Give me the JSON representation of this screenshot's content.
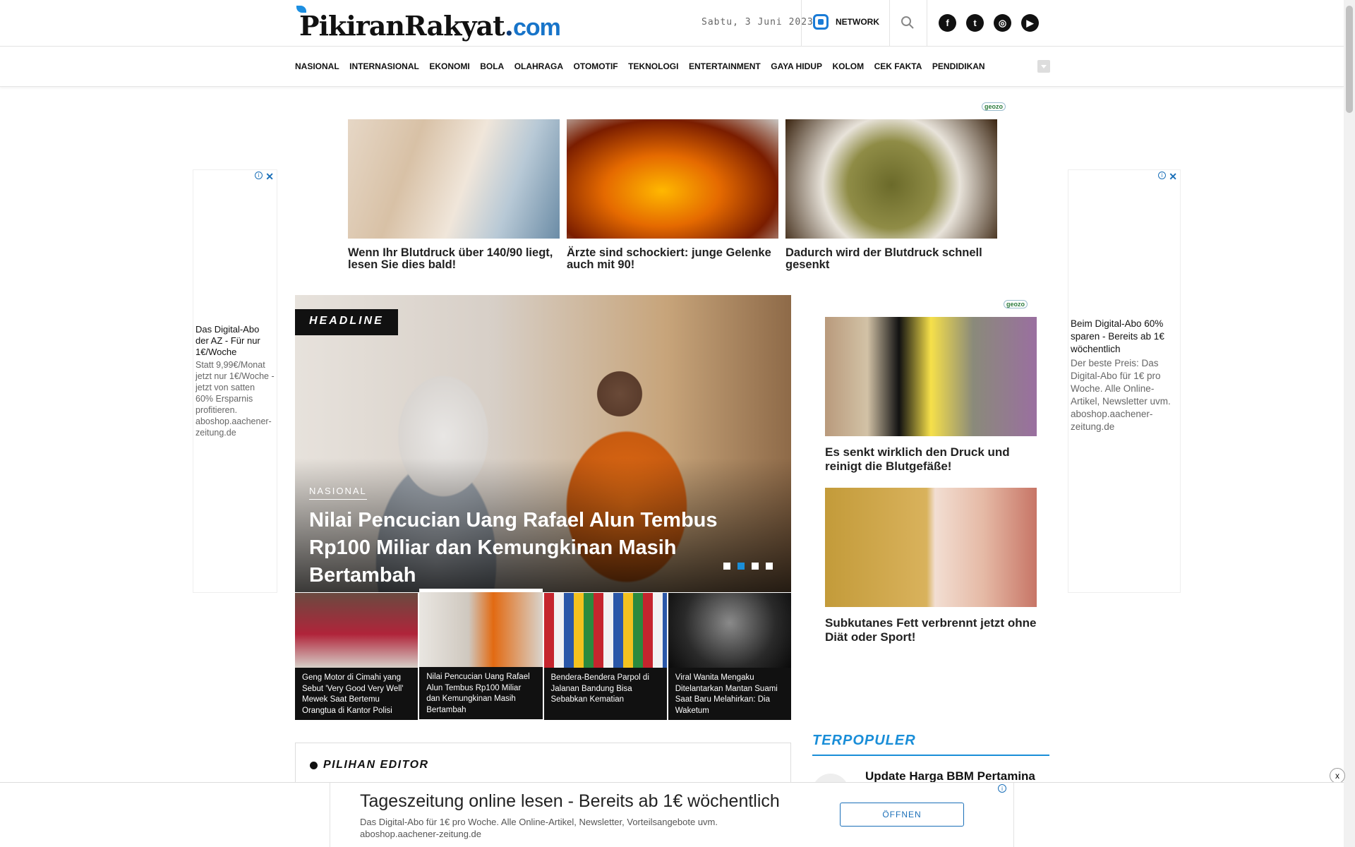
{
  "header": {
    "logo_text": "PikiranRakyat",
    "logo_suffix": "com",
    "date": "Sabtu, 3 Juni 2023",
    "network_label": "NETWORK"
  },
  "nav": [
    "NASIONAL",
    "INTERNASIONAL",
    "EKONOMI",
    "BOLA",
    "OLAHRAGA",
    "OTOMOTIF",
    "TEKNOLOGI",
    "ENTERTAINMENT",
    "GAYA HIDUP",
    "KOLOM",
    "CEK FAKTA",
    "PENDIDIKAN"
  ],
  "ad_logo": "geozo",
  "top_ads": [
    {
      "caption": "Wenn Ihr Blutdruck über 140/90 liegt, lesen Sie dies bald!"
    },
    {
      "caption": "Ärzte sind schockiert: junge Gelenke auch mit 90!"
    },
    {
      "caption": "Dadurch wird der Blutdruck schnell gesenkt"
    }
  ],
  "side_ad_left": {
    "title": "Das Digital-Abo der AZ - Für nur 1€/Woche",
    "desc": "Statt 9,99€/Monat jetzt nur 1€/Woche - jetzt von satten 60% Ersparnis profitieren. aboshop.aachener-zeitung.de"
  },
  "side_ad_right": {
    "title": "Beim Digital-Abo 60% sparen - Bereits ab 1€ wöchentlich",
    "desc": "Der beste Preis: Das Digital-Abo für 1€ pro Woche. Alle Online-Artikel, Newsletter uvm. aboshop.aachener-zeitung.de"
  },
  "headline": {
    "tag": "HEADLINE",
    "category": "NASIONAL",
    "title": "Nilai Pencucian Uang Rafael Alun Tembus Rp100 Miliar dan Kemungkinan Masih Bertambah",
    "slide_count": 4,
    "active_slide": 2
  },
  "thumbs": [
    {
      "title": "Geng Motor di Cimahi yang Sebut 'Very Good Very Well' Mewek Saat Bertemu Orangtua di Kantor Polisi"
    },
    {
      "title": "Nilai Pencucian Uang Rafael Alun Tembus Rp100 Miliar dan Kemungkinan Masih Bertambah"
    },
    {
      "title": "Bendera-Bendera Parpol di Jalanan Bandung Bisa Sebabkan Kematian"
    },
    {
      "title": "Viral Wanita Mengaku Ditelantarkan Mantan Suami Saat Baru Melahirkan: Dia Waketum"
    }
  ],
  "right_ads": [
    {
      "caption": "Es senkt wirklich den Druck und reinigt die Blutgefäße!"
    },
    {
      "caption": "Subkutanes Fett verbrennt jetzt ohne Diät oder Sport!"
    }
  ],
  "pilihan_editor": {
    "title": "PILIHAN EDITOR"
  },
  "terpopuler": {
    "title": "TERPOPULER",
    "first_item": "Update Harga BBM Pertamina"
  },
  "bottom_banner": {
    "title": "Tageszeitung online lesen - Bereits ab 1€ wöchentlich",
    "desc": "Das Digital-Abo für 1€ pro Woche. Alle Online-Artikel, Newsletter, Vorteilsangebote uvm. aboshop.aachener-zeitung.de",
    "button": "ÖFFNEN",
    "close": "x"
  },
  "colors": {
    "accent": "#1a8ed8",
    "logo_blue": "#1774c9",
    "dark": "#111111"
  }
}
